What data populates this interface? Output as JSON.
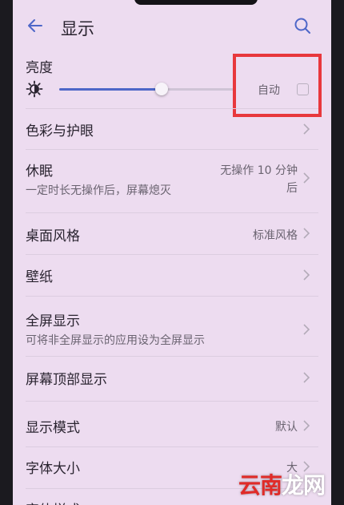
{
  "header": {
    "title": "显示",
    "back_icon": "arrow-left-icon",
    "search_icon": "search-icon"
  },
  "brightness": {
    "label": "亮度",
    "level": 0.58,
    "auto_label": "自动",
    "auto_checked": false,
    "icon": "brightness-sun-icon"
  },
  "settings": [
    {
      "title": "色彩与护眼"
    },
    {
      "title": "休眠",
      "subtitle": "一定时长无操作后，屏幕熄灭",
      "value_line1": "无操作 10 分钟",
      "value_line2": "后"
    },
    {
      "title": "桌面风格",
      "value": "标准风格"
    },
    {
      "title": "壁纸"
    },
    {
      "title": "全屏显示",
      "subtitle": "可将非全屏显示的应用设为全屏显示"
    },
    {
      "title": "屏幕顶部显示"
    },
    {
      "title": "显示模式",
      "value": "默认"
    },
    {
      "title": "字体大小",
      "value": "大"
    },
    {
      "title": "字体样式"
    }
  ],
  "watermark": {
    "text": "云南龙网"
  },
  "colors": {
    "background": "#eddcf0",
    "accent": "#4e67c8",
    "highlight": "#e8383d"
  }
}
